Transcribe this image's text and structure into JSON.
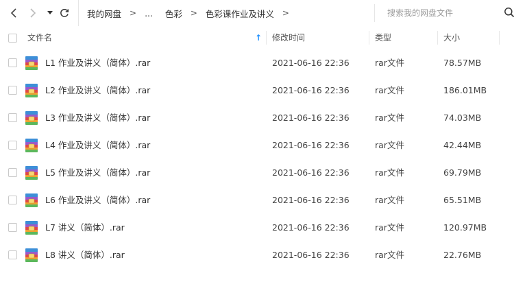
{
  "toolbar": {
    "breadcrumbs": [
      "我的网盘",
      "...",
      "色彩",
      "色彩课作业及讲义"
    ],
    "separator": ">",
    "search_placeholder": "搜索我的网盘文件"
  },
  "table": {
    "columns": {
      "name": "文件名",
      "modified": "修改时间",
      "type": "类型",
      "size": "大小"
    },
    "sort_indicator": "↑",
    "rows": [
      {
        "name": "L1 作业及讲义（简体）.rar",
        "modified": "2021-06-16 22:36",
        "type": "rar文件",
        "size": "78.57MB"
      },
      {
        "name": "L2 作业及讲义（简体）.rar",
        "modified": "2021-06-16 22:36",
        "type": "rar文件",
        "size": "186.01MB"
      },
      {
        "name": "L3 作业及讲义（简体）.rar",
        "modified": "2021-06-16 22:36",
        "type": "rar文件",
        "size": "74.03MB"
      },
      {
        "name": "L4 作业及讲义（简体）.rar",
        "modified": "2021-06-16 22:36",
        "type": "rar文件",
        "size": "42.44MB"
      },
      {
        "name": "L5 作业及讲义（简体）.rar",
        "modified": "2021-06-16 22:36",
        "type": "rar文件",
        "size": "69.79MB"
      },
      {
        "name": "L6 作业及讲义（简体）.rar",
        "modified": "2021-06-16 22:36",
        "type": "rar文件",
        "size": "65.51MB"
      },
      {
        "name": "L7 讲义（简体）.rar",
        "modified": "2021-06-16 22:36",
        "type": "rar文件",
        "size": "120.97MB"
      },
      {
        "name": "L8 讲义（简体）.rar",
        "modified": "2021-06-16 22:36",
        "type": "rar文件",
        "size": "22.76MB"
      }
    ]
  },
  "icons": {
    "back": "chevron-left-icon",
    "forward": "chevron-right-icon",
    "history": "caret-down-icon",
    "refresh": "refresh-icon",
    "search": "search-icon",
    "file": "rar-archive-icon"
  },
  "colors": {
    "accent": "#1e90ff",
    "text": "#333333"
  }
}
